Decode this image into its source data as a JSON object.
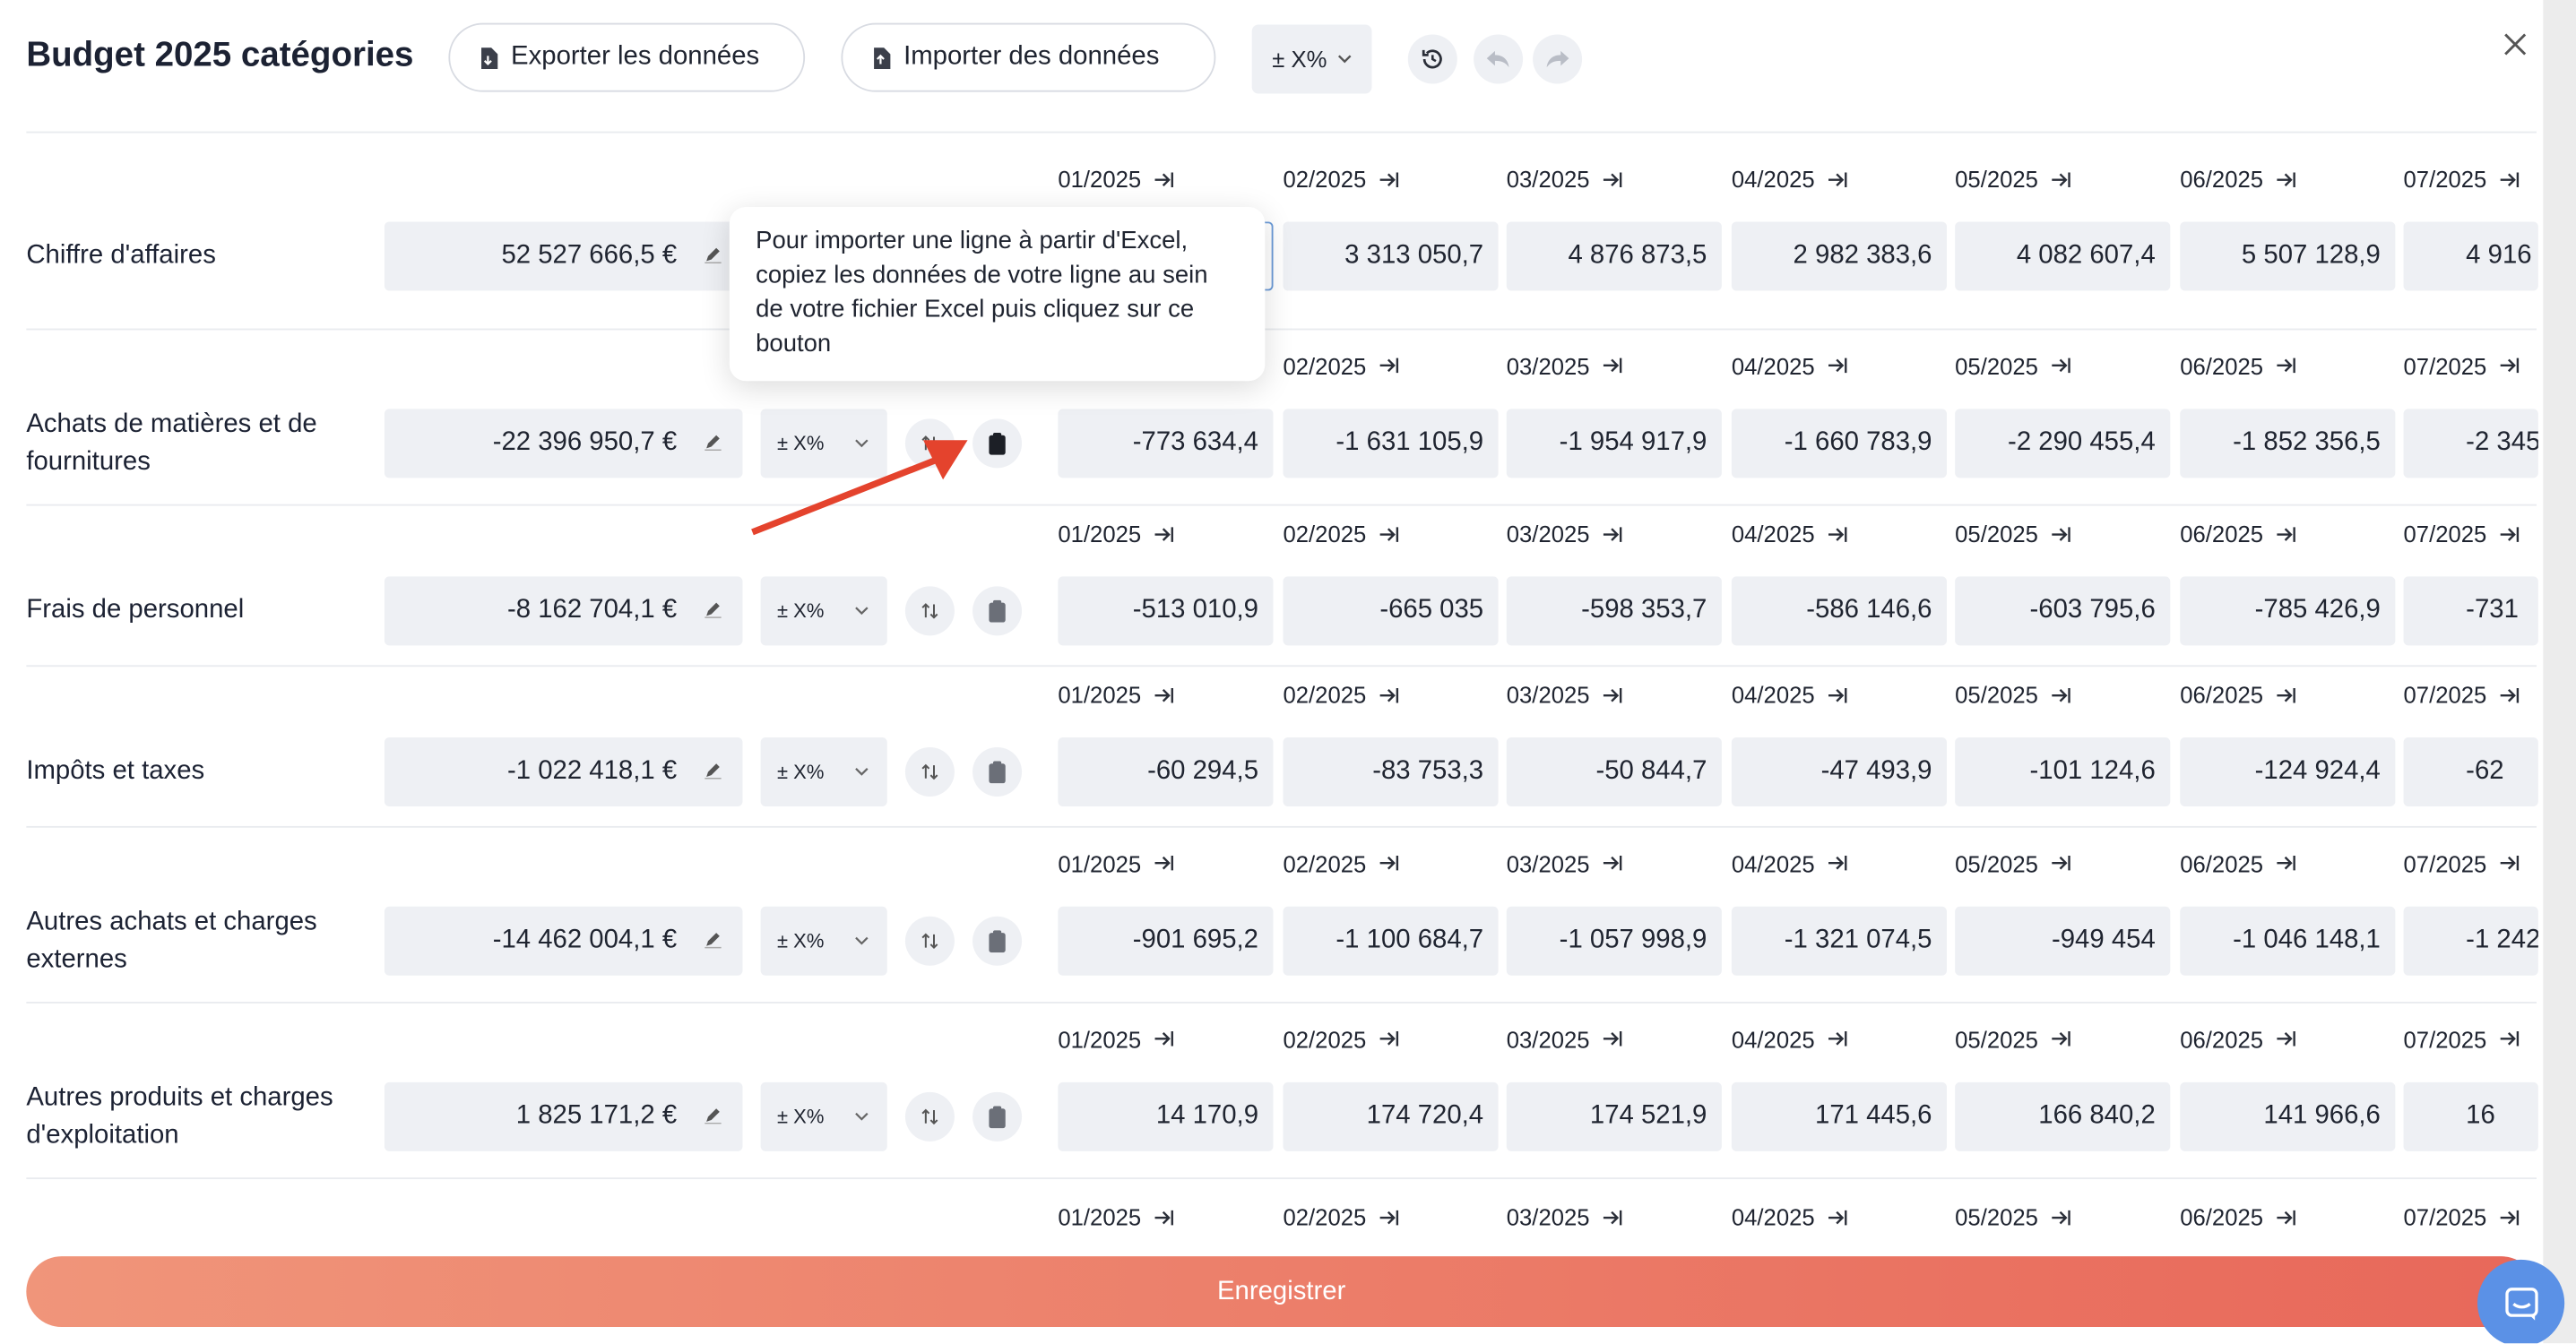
{
  "header": {
    "title": "Budget 2025 catégories",
    "export_label": "Exporter les données",
    "import_label": "Importer des données",
    "pct_label": "± X%"
  },
  "tooltip": {
    "text": "Pour importer une ligne à partir d'Excel, copiez les données de votre ligne au sein de votre fichier Excel puis cliquez sur ce bouton"
  },
  "row_pct_label": "± X%",
  "months": [
    "01/2025",
    "02/2025",
    "03/2025",
    "04/2025",
    "05/2025",
    "06/2025",
    "07/2025"
  ],
  "rows": [
    {
      "label": "Chiffre d'affaires",
      "total": "52 527 666,5 €",
      "values": [
        "",
        "3 313 050,7",
        "4 876 873,5",
        "2 982 383,6",
        "4 082 607,4",
        "5 507 128,9",
        "4 916"
      ]
    },
    {
      "label": "Achats de matières et de fournitures",
      "total": "-22 396 950,7 €",
      "values": [
        "-773 634,4",
        "-1 631 105,9",
        "-1 954 917,9",
        "-1 660 783,9",
        "-2 290 455,4",
        "-1 852 356,5",
        "-2 345"
      ]
    },
    {
      "label": "Frais de personnel",
      "total": "-8 162 704,1 €",
      "values": [
        "-513 010,9",
        "-665 035",
        "-598 353,7",
        "-586 146,6",
        "-603 795,6",
        "-785 426,9",
        "-731"
      ]
    },
    {
      "label": "Impôts et taxes",
      "total": "-1 022 418,1 €",
      "values": [
        "-60 294,5",
        "-83 753,3",
        "-50 844,7",
        "-47 493,9",
        "-101 124,6",
        "-124 924,4",
        "-62"
      ]
    },
    {
      "label": "Autres achats et charges externes",
      "total": "-14 462 004,1 €",
      "values": [
        "-901 695,2",
        "-1 100 684,7",
        "-1 057 998,9",
        "-1 321 074,5",
        "-949 454",
        "-1 046 148,1",
        "-1 242"
      ]
    },
    {
      "label": "Autres produits et charges d'exploitation",
      "total": "1 825 171,2 €",
      "values": [
        "14 170,9",
        "174 720,4",
        "174 521,9",
        "171 445,6",
        "166 840,2",
        "141 966,6",
        "16"
      ]
    }
  ],
  "save_label": "Enregistrer",
  "colors": {
    "accent_start": "#f0957a",
    "accent_end": "#e8685a",
    "annotation_arrow": "#e4432d",
    "chat": "#5b91e6"
  }
}
